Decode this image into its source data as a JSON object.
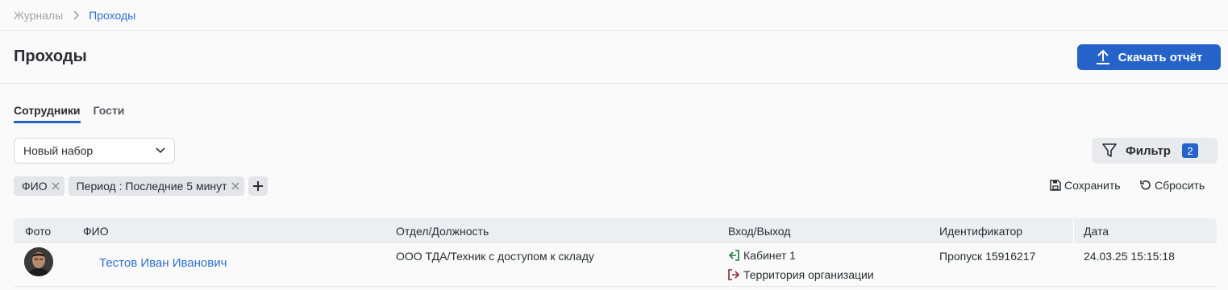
{
  "breadcrumb": {
    "root": "Журналы",
    "current": "Проходы"
  },
  "page": {
    "title": "Проходы",
    "download_label": "Скачать отчёт"
  },
  "tabs": [
    {
      "label": "Сотрудники",
      "active": true
    },
    {
      "label": "Гости",
      "active": false
    }
  ],
  "preset": {
    "value": "Новый набор"
  },
  "filter": {
    "label": "Фильтр",
    "count": "2"
  },
  "chips": [
    {
      "label": "ФИО"
    },
    {
      "label": "Период : Последние 5 минут"
    }
  ],
  "actions": {
    "save_label": "Сохранить",
    "reset_label": "Сбросить"
  },
  "table": {
    "columns": [
      "Фото",
      "ФИО",
      "Отдел/Должность",
      "Вход/Выход",
      "Идентификатор",
      "Дата"
    ],
    "rows": [
      {
        "name": "Тестов Иван Иванович",
        "department": "ООО ТДА/Техник с доступом к складу",
        "entry": "Кабинет 1",
        "exit": "Территория организации",
        "identifier": "Пропуск 15916217",
        "date": "24.03.25 15:15:18"
      }
    ]
  },
  "colors": {
    "accent": "#2563c9",
    "link": "#2f6fd1",
    "entry_icon": "#1f7a3a",
    "exit_icon": "#8a2a3a"
  }
}
